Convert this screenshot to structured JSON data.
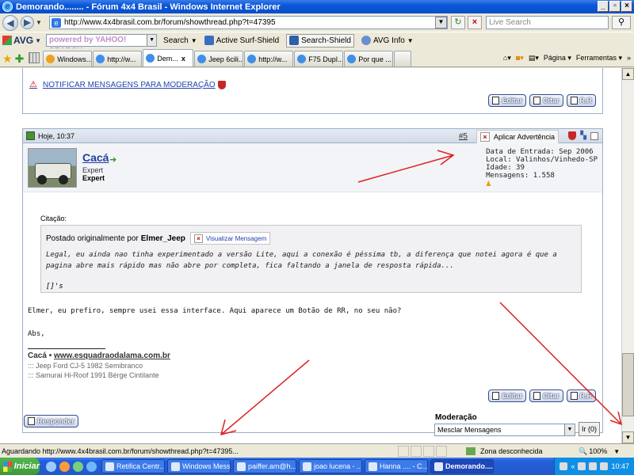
{
  "window": {
    "title": "Demorando........ - Fórum 4x4 Brasil - Windows Internet Explorer"
  },
  "address": {
    "url": "http://www.4x4brasil.com.br/forum/showthread.php?t=47395",
    "search_placeholder": "Live Search"
  },
  "avg_toolbar": {
    "logo": "AVG",
    "yahoo_placeholder": "powered by YAHOO! SEARCH",
    "search_label": "Search",
    "active_surf_shield": "Active Surf-Shield",
    "search_shield": "Search-Shield",
    "avg_info": "AVG Info"
  },
  "tabs": [
    {
      "label": "Windows..."
    },
    {
      "label": "http://w..."
    },
    {
      "label": "Dem...",
      "close": "x"
    },
    {
      "label": "Jeep 6cili..."
    },
    {
      "label": "http://w..."
    },
    {
      "label": "F75 Dupl..."
    },
    {
      "label": "Por que ..."
    },
    {
      "label": ""
    }
  ],
  "command_bar": {
    "page": "Página",
    "tools": "Ferramentas"
  },
  "prev_post": {
    "notify": "NOTIFICAR MENSAGENS PARA MODERAÇÃO",
    "edit": "Editar",
    "quote": "Citar",
    "rr": "R.R"
  },
  "post": {
    "date": "Hoje, 10:37",
    "number": "#5",
    "warning_button": "Aplicar Advertência",
    "user": {
      "name": "Cacá",
      "title": "Expert",
      "rank": "Expert"
    },
    "info": {
      "joined": "Data de Entrada: Sep 2006",
      "location": "Local: Valinhos/Vinhedo-SP",
      "age": "Idade: 39",
      "posts": "Mensagens: 1.558"
    },
    "quote_label": "Citação:",
    "quote_author_prefix": "Postado originalmente por",
    "quote_author": "Elmer_Jeep",
    "view_message": "Visualizar Mensagem",
    "quote_text": "Legal, eu ainda nao tinha experimentado a versão Lite, aqui a conexão é péssima tb, a diferença que notei agora é que a pagina abre mais rápido mas não abre por completa, fica faltando a janela de resposta rápida...",
    "quote_sig": "[]'s",
    "body_line1": "Elmer, eu prefiro, sempre usei essa interface. Aqui aparece um Botão de RR, no seu não?",
    "body_line2": "Abs,",
    "sig_name": "Cacá",
    "sig_sep": "•",
    "sig_site": "www.esquadraodalama.com.br",
    "sig_car1": "::: Jeep Ford CJ-5 1982 Semibranco",
    "sig_car2": "::: Samurai Hi-Roof 1991 Bérge Cintilante",
    "edit": "Editar",
    "quote": "Citar",
    "rr": "R.R"
  },
  "footer": {
    "reply": "Responder",
    "moderation_label": "Moderação",
    "moderation_option": "Mesclar Mensagens",
    "go": "Ir (0)"
  },
  "statusbar": {
    "text": "Aguardando http://www.4x4brasil.com.br/forum/showthread.php?t=47395...",
    "zone": "Zona desconhecida",
    "zoom": "100%"
  },
  "taskbar": {
    "start": "Iniciar",
    "tasks": [
      {
        "label": "Retifica Centr..."
      },
      {
        "label": "Windows Mess..."
      },
      {
        "label": "paiffer.am@h..."
      },
      {
        "label": "joao lucena - ..."
      },
      {
        "label": "Hanna .... - C..."
      },
      {
        "label": "Demorando...."
      }
    ],
    "clock": "10:47"
  }
}
